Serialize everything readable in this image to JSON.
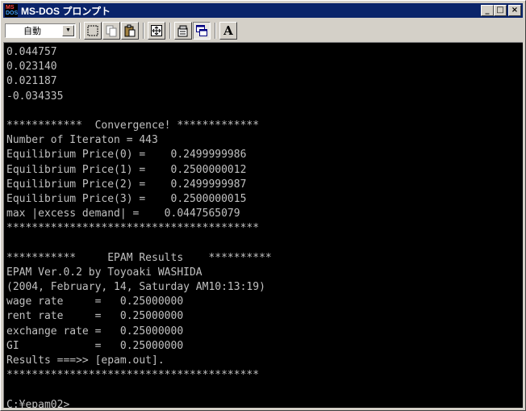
{
  "window": {
    "title": "MS-DOS プロンプト",
    "buttons": {
      "minimize": "_",
      "maximize": "□",
      "close": "×"
    }
  },
  "toolbar": {
    "font_size_value": "自動",
    "tools": [
      "mark-icon",
      "copy-icon",
      "paste-icon",
      "fullscreen-icon",
      "properties-icon",
      "background-icon",
      "font-icon"
    ],
    "font_button_label": "A"
  },
  "console": {
    "lines": [
      "0.044757",
      "0.023140",
      "0.021187",
      "-0.034335",
      "",
      "************  Convergence! *************",
      "Number of Iteraton = 443",
      "Equilibrium Price(0) =    0.2499999986",
      "Equilibrium Price(1) =    0.2500000012",
      "Equilibrium Price(2) =    0.2499999987",
      "Equilibrium Price(3) =    0.2500000015",
      "max |excess demand| =    0.0447565079",
      "****************************************",
      "",
      "***********     EPAM Results    **********",
      "EPAM Ver.0.2 by Toyoaki WASHIDA",
      "(2004, February, 14, Saturday AM10:13:19)",
      "wage rate     =   0.25000000",
      "rent rate     =   0.25000000",
      "exchange rate =   0.25000000",
      "GI            =   0.25000000",
      "Results ===>> [epam.out].",
      "****************************************",
      "",
      "C:¥epam02>"
    ]
  },
  "colors": {
    "titlebar": "#0a246a",
    "console_bg": "#000000",
    "console_fg": "#c0c0c0",
    "chrome": "#d4d0c8"
  }
}
